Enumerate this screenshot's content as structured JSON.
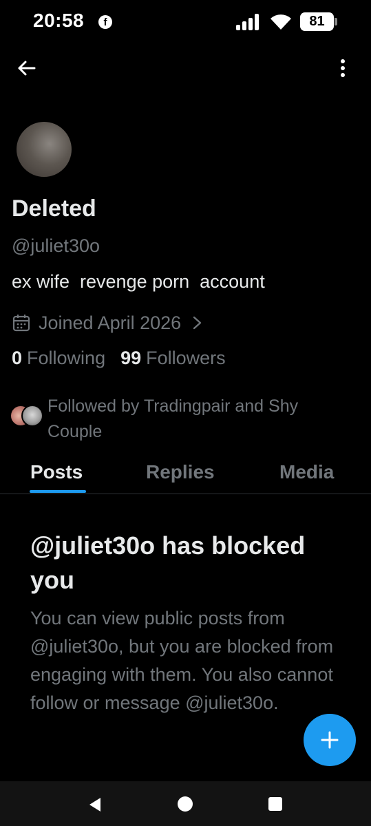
{
  "status_bar": {
    "time": "20:58",
    "notification_icon": "facebook-icon",
    "signal_icon": "signal-icon",
    "wifi_icon": "wifi-icon",
    "battery_level": "81"
  },
  "header": {
    "back_icon": "arrow-left-icon",
    "more_icon": "more-vertical-icon"
  },
  "profile": {
    "display_name": "Deleted",
    "handle": "@juliet30o",
    "bio": "ex wife  revenge porn  account",
    "joined": "Joined April 2026",
    "following_count": "0",
    "following_label": "Following",
    "followers_count": "99",
    "followers_label": "Followers",
    "followed_by": "Followed by Tradingpair and Shy Couple"
  },
  "tabs": [
    {
      "label": "Posts",
      "selected": true
    },
    {
      "label": "Replies",
      "selected": false
    },
    {
      "label": "Media",
      "selected": false
    }
  ],
  "blocked_notice": {
    "title": "@juliet30o has blocked you",
    "body": "You can view public posts from @juliet30o, but you are blocked from engaging with them. You also cannot follow or message @juliet30o."
  },
  "fab_icon": "plus-icon",
  "nav_bar": {
    "back_icon": "nav-back-icon",
    "home_icon": "nav-home-icon",
    "recents_icon": "nav-recents-icon"
  },
  "colors": {
    "background": "#000000",
    "accent": "#1d9bf0",
    "primary_text": "#e7e9ea",
    "secondary_text": "#71767b"
  }
}
